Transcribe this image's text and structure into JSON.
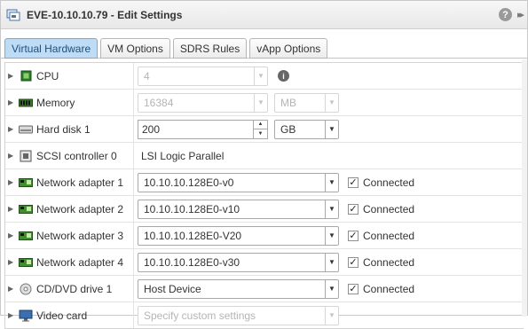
{
  "window": {
    "title": "EVE-10.10.10.79 - Edit Settings",
    "help_glyph": "?",
    "expand_glyph": "▸▸"
  },
  "tabs": [
    {
      "label": "Virtual Hardware",
      "active": true
    },
    {
      "label": "VM Options",
      "active": false
    },
    {
      "label": "SDRS Rules",
      "active": false
    },
    {
      "label": "vApp Options",
      "active": false
    }
  ],
  "hardware": {
    "cpu": {
      "label": "CPU",
      "value": "4",
      "icon": "cpu-icon"
    },
    "memory": {
      "label": "Memory",
      "value": "16384",
      "unit": "MB",
      "icon": "memory-icon"
    },
    "hard_disk": {
      "label": "Hard disk 1",
      "value": "200",
      "unit": "GB",
      "icon": "hard-disk-icon"
    },
    "scsi": {
      "label": "SCSI controller 0",
      "value": "LSI Logic Parallel",
      "icon": "scsi-icon"
    },
    "network_adapters": [
      {
        "label": "Network adapter 1",
        "network": "10.10.10.128E0-v0",
        "connected_label": "Connected",
        "connected": true
      },
      {
        "label": "Network adapter 2",
        "network": "10.10.10.128E0-v10",
        "connected_label": "Connected",
        "connected": true
      },
      {
        "label": "Network adapter 3",
        "network": "10.10.10.128E0-V20",
        "connected_label": "Connected",
        "connected": true
      },
      {
        "label": "Network adapter 4",
        "network": "10.10.10.128E0-v30",
        "connected_label": "Connected",
        "connected": true
      }
    ],
    "cd_dvd": {
      "label": "CD/DVD drive 1",
      "value": "Host Device",
      "connected_label": "Connected",
      "connected": true,
      "icon": "cd-dvd-icon"
    },
    "video_card": {
      "label": "Video card",
      "placeholder": "Specify custom settings",
      "icon": "video-card-icon"
    }
  },
  "colors": {
    "active_tab_bg": "#bfdcf6",
    "nic_icon_green": "#3f8f2f"
  }
}
